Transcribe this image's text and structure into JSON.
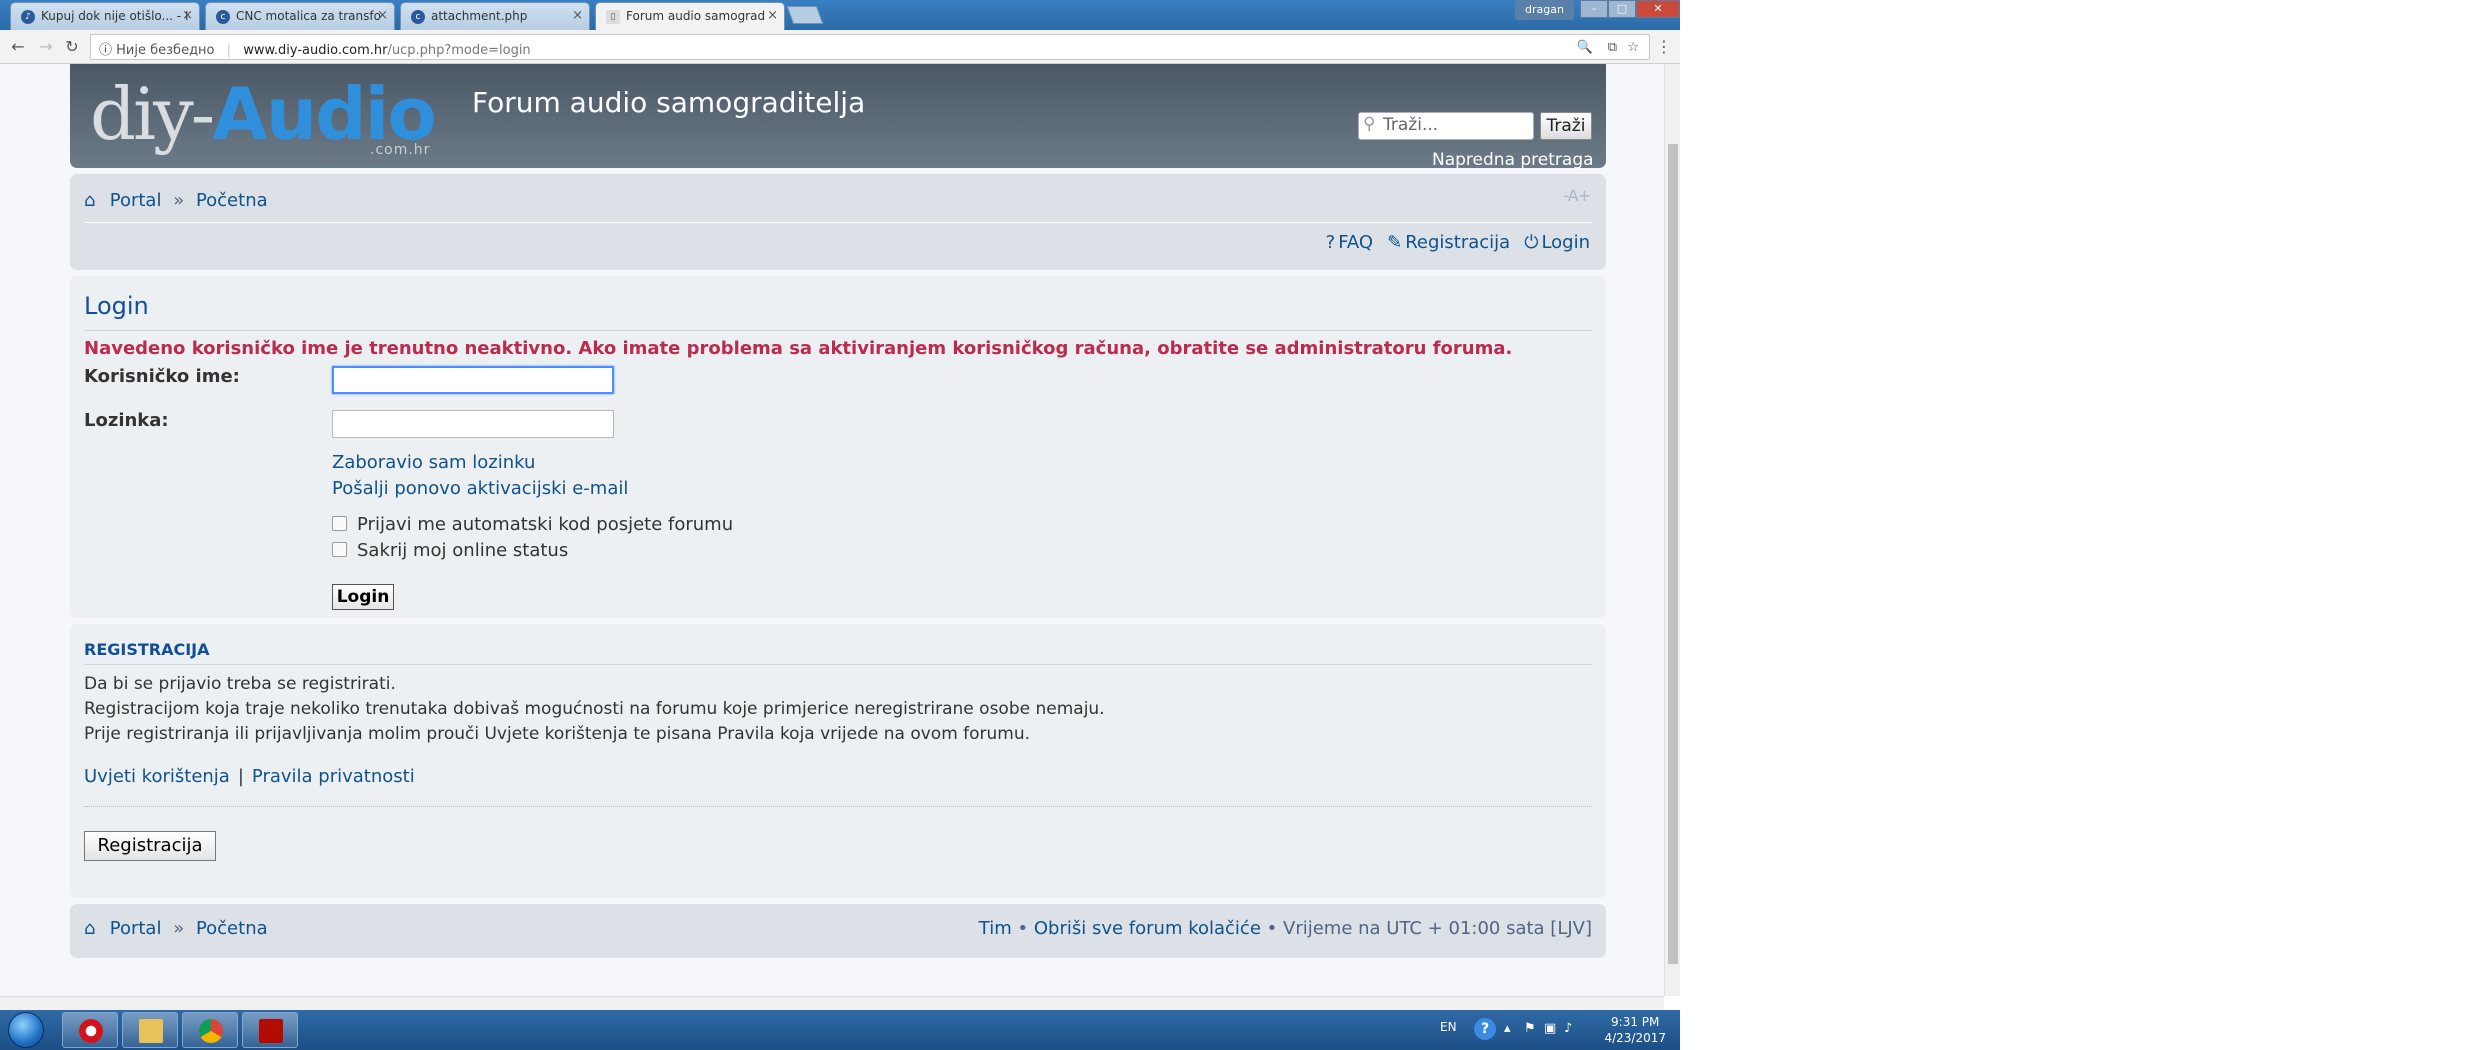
{
  "browser": {
    "tabs": [
      {
        "title": "Kupuj dok nije otišlo... - I",
        "active": false
      },
      {
        "title": "CNC motalica za transfo",
        "active": false
      },
      {
        "title": "attachment.php",
        "active": false
      },
      {
        "title": "Forum audio samograd",
        "active": true
      }
    ],
    "user": "dragan",
    "security_label": "Није безбедно",
    "url_host": "www.diy-audio.com.hr",
    "url_path": "/ucp.php?mode=login"
  },
  "header": {
    "logo_diy": "diy-",
    "logo_audio": "Audio",
    "logo_domain": ".com.hr",
    "site_title": "Forum audio samograditelja",
    "search_placeholder": "Traži...",
    "search_button": "Traži",
    "advanced_search": "Napredna pretraga"
  },
  "navbar": {
    "crumb_portal": "Portal",
    "crumb_sep": "»",
    "crumb_index": "Početna",
    "font_size": "-A+",
    "faq": "FAQ",
    "register": "Registracija",
    "login": "Login"
  },
  "login": {
    "title": "Login",
    "error": "Navedeno korisničko ime je trenutno neaktivno. Ako imate problema sa aktiviranjem korisničkog računa, obratite se administratoru foruma.",
    "username_label": "Korisničko ime:",
    "password_label": "Lozinka:",
    "forgot_password": "Zaboravio sam lozinku",
    "resend_activation": "Pošalji ponovo aktivacijski e-mail",
    "autologin_label": "Prijavi me automatski kod posjete forumu",
    "hide_online_label": "Sakrij moj online status",
    "submit": "Login"
  },
  "registration": {
    "title": "REGISTRACIJA",
    "line1": "Da bi se prijavio treba se registrirati.",
    "line2": "Registracijom koja traje nekoliko trenutaka dobivaš mogućnosti na forumu koje primjerice neregistrirane osobe nemaju.",
    "line3": "Prije registriranja ili prijavljivanja molim prouči Uvjete korištenja te pisana Pravila koja vrijede na ovom forumu.",
    "terms_link": "Uvjeti korištenja",
    "links_sep": "|",
    "privacy_link": "Pravila privatnosti",
    "button": "Registracija"
  },
  "footer": {
    "crumb_portal": "Portal",
    "crumb_sep": "»",
    "crumb_index": "Početna",
    "team": "Tim",
    "bullet": "•",
    "delete_cookies": "Obriši sve forum kolačiće",
    "timezone": "Vrijeme na UTC + 01:00 sata [LJV]"
  },
  "taskbar": {
    "lang": "EN",
    "time": "9:31 PM",
    "date": "4/23/2017"
  }
}
